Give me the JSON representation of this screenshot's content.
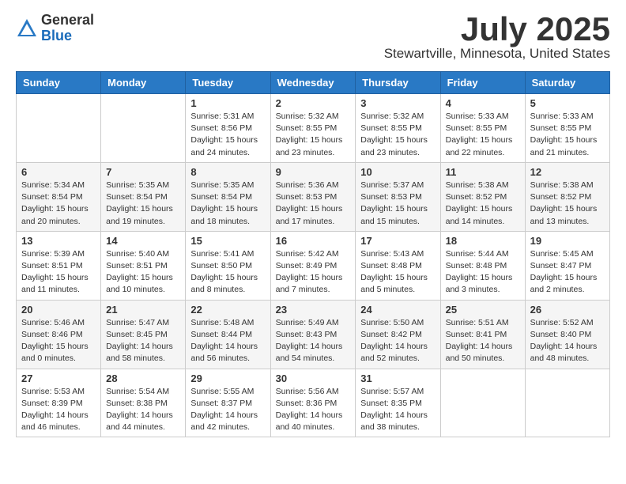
{
  "header": {
    "logo_general": "General",
    "logo_blue": "Blue",
    "month_title": "July 2025",
    "location": "Stewartville, Minnesota, United States"
  },
  "weekdays": [
    "Sunday",
    "Monday",
    "Tuesday",
    "Wednesday",
    "Thursday",
    "Friday",
    "Saturday"
  ],
  "weeks": [
    [
      {
        "day": "",
        "detail": ""
      },
      {
        "day": "",
        "detail": ""
      },
      {
        "day": "1",
        "detail": "Sunrise: 5:31 AM\nSunset: 8:56 PM\nDaylight: 15 hours\nand 24 minutes."
      },
      {
        "day": "2",
        "detail": "Sunrise: 5:32 AM\nSunset: 8:55 PM\nDaylight: 15 hours\nand 23 minutes."
      },
      {
        "day": "3",
        "detail": "Sunrise: 5:32 AM\nSunset: 8:55 PM\nDaylight: 15 hours\nand 23 minutes."
      },
      {
        "day": "4",
        "detail": "Sunrise: 5:33 AM\nSunset: 8:55 PM\nDaylight: 15 hours\nand 22 minutes."
      },
      {
        "day": "5",
        "detail": "Sunrise: 5:33 AM\nSunset: 8:55 PM\nDaylight: 15 hours\nand 21 minutes."
      }
    ],
    [
      {
        "day": "6",
        "detail": "Sunrise: 5:34 AM\nSunset: 8:54 PM\nDaylight: 15 hours\nand 20 minutes."
      },
      {
        "day": "7",
        "detail": "Sunrise: 5:35 AM\nSunset: 8:54 PM\nDaylight: 15 hours\nand 19 minutes."
      },
      {
        "day": "8",
        "detail": "Sunrise: 5:35 AM\nSunset: 8:54 PM\nDaylight: 15 hours\nand 18 minutes."
      },
      {
        "day": "9",
        "detail": "Sunrise: 5:36 AM\nSunset: 8:53 PM\nDaylight: 15 hours\nand 17 minutes."
      },
      {
        "day": "10",
        "detail": "Sunrise: 5:37 AM\nSunset: 8:53 PM\nDaylight: 15 hours\nand 15 minutes."
      },
      {
        "day": "11",
        "detail": "Sunrise: 5:38 AM\nSunset: 8:52 PM\nDaylight: 15 hours\nand 14 minutes."
      },
      {
        "day": "12",
        "detail": "Sunrise: 5:38 AM\nSunset: 8:52 PM\nDaylight: 15 hours\nand 13 minutes."
      }
    ],
    [
      {
        "day": "13",
        "detail": "Sunrise: 5:39 AM\nSunset: 8:51 PM\nDaylight: 15 hours\nand 11 minutes."
      },
      {
        "day": "14",
        "detail": "Sunrise: 5:40 AM\nSunset: 8:51 PM\nDaylight: 15 hours\nand 10 minutes."
      },
      {
        "day": "15",
        "detail": "Sunrise: 5:41 AM\nSunset: 8:50 PM\nDaylight: 15 hours\nand 8 minutes."
      },
      {
        "day": "16",
        "detail": "Sunrise: 5:42 AM\nSunset: 8:49 PM\nDaylight: 15 hours\nand 7 minutes."
      },
      {
        "day": "17",
        "detail": "Sunrise: 5:43 AM\nSunset: 8:48 PM\nDaylight: 15 hours\nand 5 minutes."
      },
      {
        "day": "18",
        "detail": "Sunrise: 5:44 AM\nSunset: 8:48 PM\nDaylight: 15 hours\nand 3 minutes."
      },
      {
        "day": "19",
        "detail": "Sunrise: 5:45 AM\nSunset: 8:47 PM\nDaylight: 15 hours\nand 2 minutes."
      }
    ],
    [
      {
        "day": "20",
        "detail": "Sunrise: 5:46 AM\nSunset: 8:46 PM\nDaylight: 15 hours\nand 0 minutes."
      },
      {
        "day": "21",
        "detail": "Sunrise: 5:47 AM\nSunset: 8:45 PM\nDaylight: 14 hours\nand 58 minutes."
      },
      {
        "day": "22",
        "detail": "Sunrise: 5:48 AM\nSunset: 8:44 PM\nDaylight: 14 hours\nand 56 minutes."
      },
      {
        "day": "23",
        "detail": "Sunrise: 5:49 AM\nSunset: 8:43 PM\nDaylight: 14 hours\nand 54 minutes."
      },
      {
        "day": "24",
        "detail": "Sunrise: 5:50 AM\nSunset: 8:42 PM\nDaylight: 14 hours\nand 52 minutes."
      },
      {
        "day": "25",
        "detail": "Sunrise: 5:51 AM\nSunset: 8:41 PM\nDaylight: 14 hours\nand 50 minutes."
      },
      {
        "day": "26",
        "detail": "Sunrise: 5:52 AM\nSunset: 8:40 PM\nDaylight: 14 hours\nand 48 minutes."
      }
    ],
    [
      {
        "day": "27",
        "detail": "Sunrise: 5:53 AM\nSunset: 8:39 PM\nDaylight: 14 hours\nand 46 minutes."
      },
      {
        "day": "28",
        "detail": "Sunrise: 5:54 AM\nSunset: 8:38 PM\nDaylight: 14 hours\nand 44 minutes."
      },
      {
        "day": "29",
        "detail": "Sunrise: 5:55 AM\nSunset: 8:37 PM\nDaylight: 14 hours\nand 42 minutes."
      },
      {
        "day": "30",
        "detail": "Sunrise: 5:56 AM\nSunset: 8:36 PM\nDaylight: 14 hours\nand 40 minutes."
      },
      {
        "day": "31",
        "detail": "Sunrise: 5:57 AM\nSunset: 8:35 PM\nDaylight: 14 hours\nand 38 minutes."
      },
      {
        "day": "",
        "detail": ""
      },
      {
        "day": "",
        "detail": ""
      }
    ]
  ]
}
